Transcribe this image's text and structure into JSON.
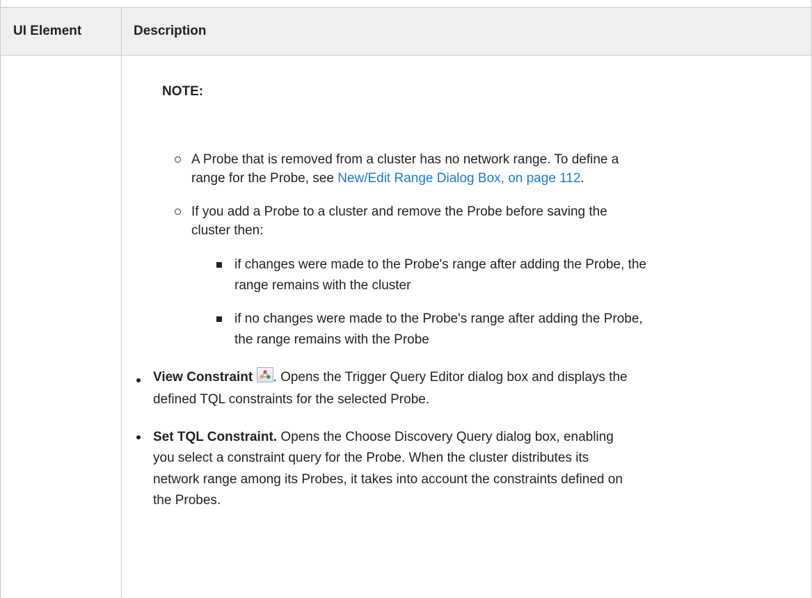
{
  "header": {
    "col1": "UI Element",
    "col2": "Description"
  },
  "note_label": "NOTE:",
  "sub_bullets": [
    {
      "line1": "A Probe that is removed from a cluster has no network range. To define a",
      "line2_prefix": "range for the Probe, see ",
      "link": "New/Edit Range Dialog Box, on page 112",
      "line2_suffix": "."
    },
    {
      "line1": "If you add a Probe to a cluster and remove the Probe before saving the",
      "line2": "cluster then:"
    }
  ],
  "square_bullets": [
    {
      "line1": "if changes were made to the Probe's range after adding the Probe, the",
      "line2": "range remains with the cluster"
    },
    {
      "line1": "if no changes were made to the Probe's range after adding the Probe,",
      "line2": "the range remains with the Probe"
    }
  ],
  "main_bullets": [
    {
      "title": "View Constraint",
      "icon": "view-constraint-icon",
      "line1_rest": ". Opens the Trigger Query Editor dialog box and displays the",
      "line2": "defined TQL constraints for the selected Probe."
    },
    {
      "title": "Set TQL Constraint.",
      "line1_rest": " Opens the Choose Discovery Query dialog box, enabling",
      "line2": "you select a constraint query for the Probe. When the cluster distributes its",
      "line3": "network range among its Probes, it takes into account the constraints defined on",
      "line4": "the Probes."
    }
  ]
}
